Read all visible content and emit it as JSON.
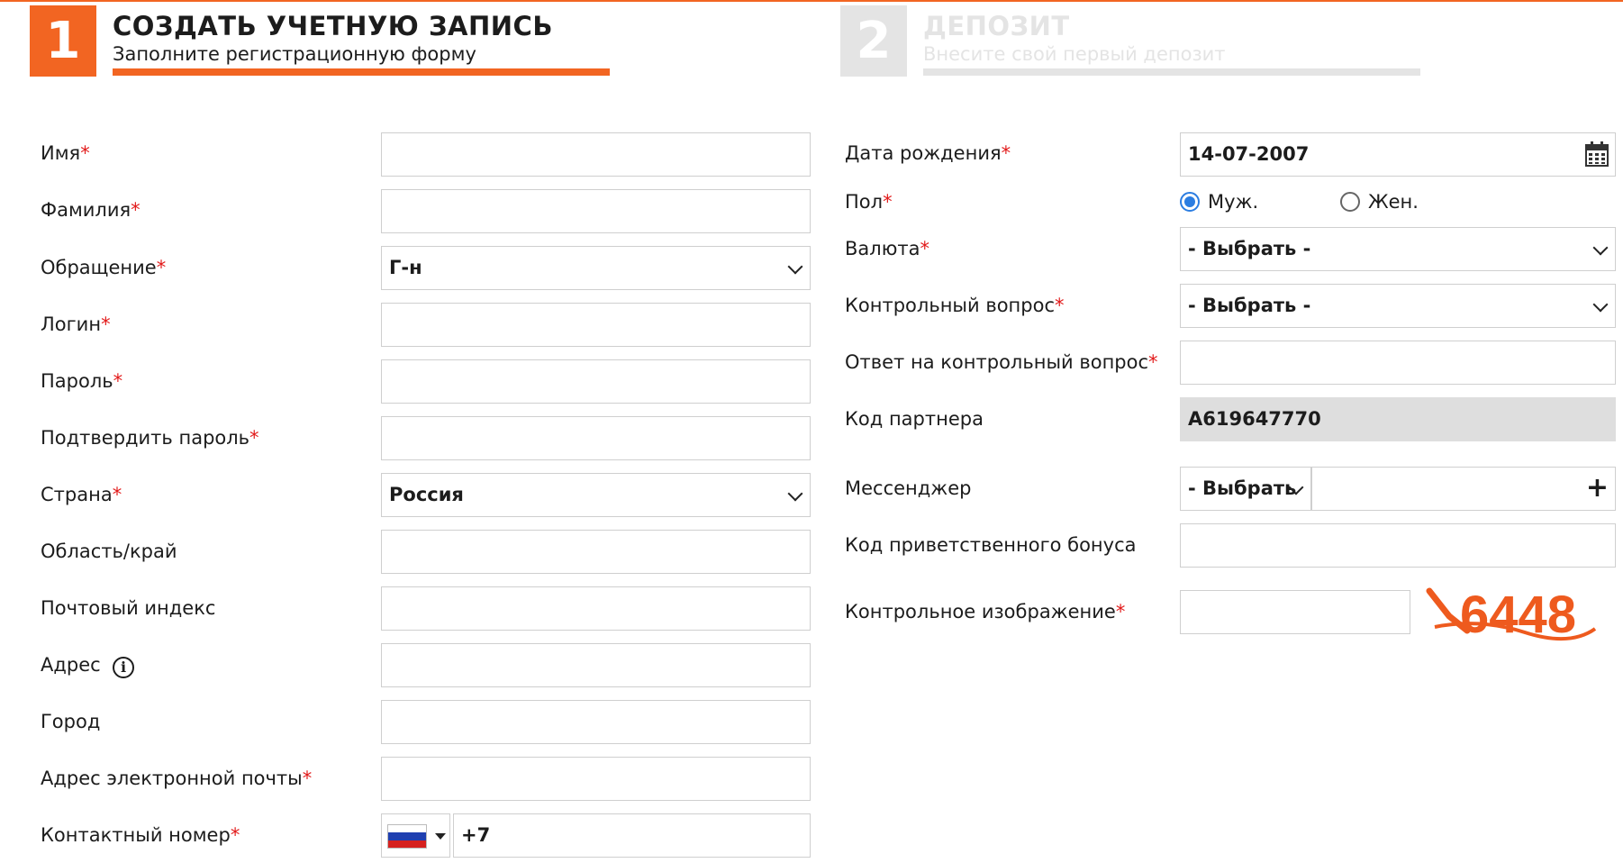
{
  "steps": [
    {
      "number": "1",
      "title": "СОЗДАТЬ УЧЕТНУЮ ЗАПИСЬ",
      "subtitle": "Заполните регистрационную форму"
    },
    {
      "number": "2",
      "title": "ДЕПОЗИТ",
      "subtitle": "Внесите свой первый депозит"
    }
  ],
  "required_mark": "*",
  "left_form": {
    "first_name": {
      "label": "Имя",
      "value": ""
    },
    "last_name": {
      "label": "Фамилия",
      "value": ""
    },
    "salutation": {
      "label": "Обращение",
      "value": "Г-н"
    },
    "login": {
      "label": "Логин",
      "value": ""
    },
    "password": {
      "label": "Пароль",
      "value": ""
    },
    "confirm_password": {
      "label": "Подтвердить пароль",
      "value": ""
    },
    "country": {
      "label": "Страна",
      "value": "Россия"
    },
    "region": {
      "label": "Область/край",
      "value": ""
    },
    "postal_code": {
      "label": "Почтовый индекс",
      "value": ""
    },
    "address": {
      "label": "Адрес",
      "value": "",
      "info_icon": "i"
    },
    "city": {
      "label": "Город",
      "value": ""
    },
    "email": {
      "label": "Адрес электронной почты",
      "value": ""
    },
    "phone": {
      "label": "Контактный номер",
      "prefix": "+7",
      "flag": "russia-flag"
    }
  },
  "right_form": {
    "birth_date": {
      "label": "Дата рождения",
      "value": "14-07-2007"
    },
    "gender": {
      "label": "Пол",
      "options": [
        "Муж.",
        "Жен."
      ],
      "selected": "Муж."
    },
    "currency": {
      "label": "Валюта",
      "value": "- Выбрать -"
    },
    "security_question": {
      "label": "Контрольный вопрос",
      "value": "- Выбрать -"
    },
    "security_answer": {
      "label": "Ответ на контрольный вопрос",
      "value": ""
    },
    "partner_code": {
      "label": "Код партнера",
      "value": "A619647770"
    },
    "messenger": {
      "label": "Мессенджер",
      "value": "- Выбрать",
      "add": "+"
    },
    "bonus_code": {
      "label": "Код приветственного бонуса",
      "value": ""
    },
    "captcha": {
      "label": "Контрольное изображение",
      "value": "",
      "image_text": "6448"
    }
  },
  "colors": {
    "accent": "#f26522",
    "inactive": "#e4e4e4",
    "required": "#e21a1a",
    "radio": "#2b7de1",
    "readonly": "#dedede"
  }
}
